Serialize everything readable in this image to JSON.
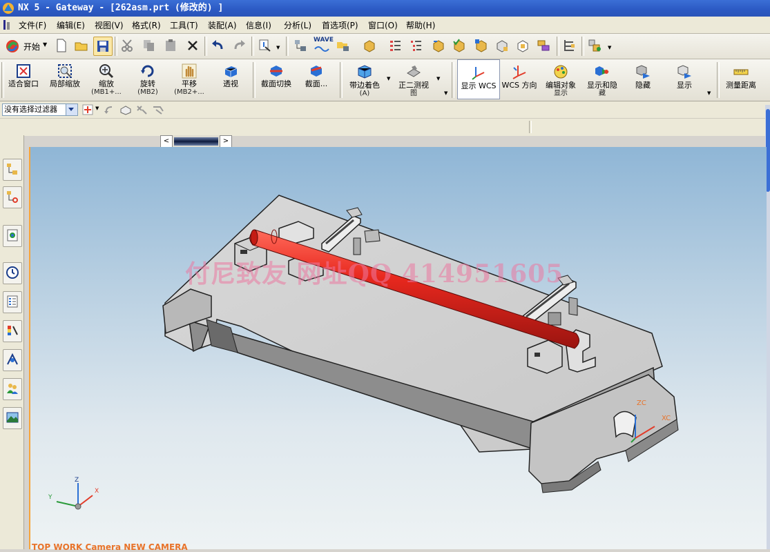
{
  "window": {
    "title": "NX 5 - Gateway - [262asm.prt  (修改的) ]"
  },
  "menubar": {
    "items": [
      "文件(F)",
      "编辑(E)",
      "视图(V)",
      "格式(R)",
      "工具(T)",
      "装配(A)",
      "信息(I)",
      "分析(L)",
      "首选项(P)",
      "窗口(O)",
      "帮助(H)"
    ]
  },
  "standard_toolbar": {
    "start_label": "开始",
    "wave_label": "WAVE"
  },
  "view_toolbar": {
    "fit": "适合窗口",
    "zoom_region": "局部缩放",
    "zoom": "缩放",
    "zoom_sub": "(MB1+...",
    "rotate": "旋转",
    "rotate_sub": "(MB2)",
    "pan": "平移",
    "pan_sub": "(MB2+...",
    "perspective": "透视",
    "clip_section": "截面切换",
    "section": "截面...",
    "shaded_edges": "带边着色",
    "shaded_edges_sub": "(A)",
    "trimetric": "正二测视",
    "trimetric_sub": "图",
    "show_wcs": "显示 WCS",
    "wcs_orient": "WCS 方向",
    "edit_display": "编辑对象",
    "edit_display_sub": "显示",
    "show_hide": "显示和隐",
    "show_hide_sub": "藏",
    "hide": "隐藏",
    "show": "显示",
    "measure": "测量距离"
  },
  "selection_bar": {
    "filter_value": "没有选择过滤器"
  },
  "viewport": {
    "watermark": "付尼致友 网址QQ 414951605",
    "camera_label": "TOP WORK Camera NEW CAMERA",
    "triad": {
      "x": "X",
      "y": "Y",
      "z": "Z"
    },
    "wcs": {
      "zc": "ZC",
      "xc": "XC"
    }
  },
  "colors": {
    "title_bar": "#2b59c3",
    "rod": "#e8281e",
    "wcs_label": "#e8732a",
    "background_top": "#8fb6d6",
    "background_bottom": "#eef3f4"
  }
}
